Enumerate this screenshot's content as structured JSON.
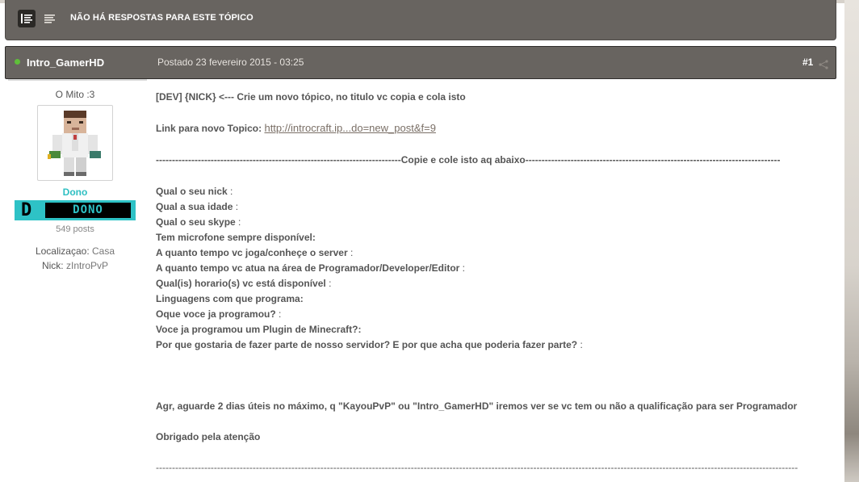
{
  "topic": {
    "title": "NÃO HÁ RESPOSTAS PARA ESTE TÓPICO",
    "view_modes": [
      "threaded-view-icon",
      "list-view-icon"
    ]
  },
  "post": {
    "author": "Intro_GamerHD",
    "date": "Postado 23 fevereiro 2015 - 03:25",
    "number": "#1"
  },
  "author_info": {
    "title": "O Mito :3",
    "group": "Dono",
    "rank_letter": "D",
    "rank_label": "DONO",
    "post_count": "549 posts",
    "fields": [
      {
        "label": "Localizaçao:",
        "value": "Casa"
      },
      {
        "label": "Nick:",
        "value": "zIntroPvP"
      }
    ]
  },
  "body": {
    "line1": "[DEV]  {NICK} <--- Crie um novo tópico, no titulo vc copia e cola isto",
    "link_label": "Link para novo Topico:",
    "link_text": "http://introcraft.ip...do=new_post&f=9",
    "separator1": "----------------------------------------------------------------------------Copie e cole isto aq abaixo-------------------------------------------------------------------------------",
    "questions": [
      {
        "q": "Qual o seu nick",
        "s": " :"
      },
      {
        "q": "Qual a sua idade",
        "s": " :"
      },
      {
        "q": "Qual o seu skype",
        "s": " :"
      },
      {
        "q": "Tem microfone sempre disponível:",
        "s": ""
      },
      {
        "q": "A quanto tempo vc joga/conheçe o server",
        "s": " :"
      },
      {
        "q": "A quanto tempo vc atua na área de Programador/Developer/Editor",
        "s": " :"
      },
      {
        "q": "Qual(is) horario(s) vc está disponível",
        "s": " :"
      },
      {
        "q": "Linguagens com que programa:",
        "s": ""
      },
      {
        "q": "Oque voce ja programou?",
        "s": " :"
      },
      {
        "q": "Voce ja programou um Plugin de Minecraft?:",
        "s": ""
      },
      {
        "q": "Por que gostaria de fazer parte de nosso servidor? E por que acha que poderia fazer parte?",
        "s": " :"
      }
    ],
    "closing": "Agr, aguarde 2 dias úteis no máximo, q \"KayouPvP\" ou \"Intro_GamerHD\" iremos ver se vc tem ou não a qualificação para ser Programador",
    "thanks": "Obrigado pela atenção",
    "separator2": "-------------------------------------------------------------------------------------------------------------------------------------------------------------------------------------------------------"
  }
}
